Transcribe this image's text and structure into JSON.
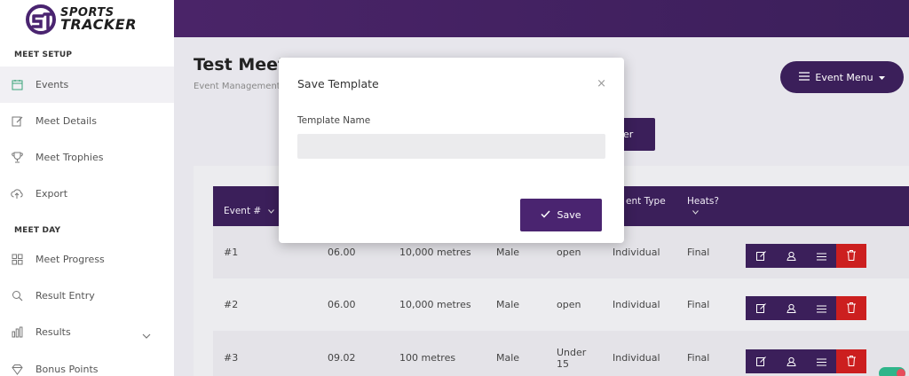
{
  "app": {
    "logo_line1": "SPORTS",
    "logo_line2": "TRACKER"
  },
  "sidebar": {
    "sections": [
      {
        "label": "MEET SETUP"
      },
      {
        "label": "MEET DAY"
      }
    ],
    "items": [
      {
        "label": "Events",
        "icon": "calendar-icon"
      },
      {
        "label": "Meet Details",
        "icon": "edit-icon"
      },
      {
        "label": "Meet Trophies",
        "icon": "trophy-icon"
      },
      {
        "label": "Export",
        "icon": "cloud-upload-icon"
      },
      {
        "label": "Meet Progress",
        "icon": "grid-icon"
      },
      {
        "label": "Result Entry",
        "icon": "search-icon"
      },
      {
        "label": "Results",
        "icon": "bar-chart-icon"
      },
      {
        "label": "Bonus Points",
        "icon": "diamond-icon"
      }
    ]
  },
  "header": {
    "title": "Test Meet",
    "subtitle": "Event Management",
    "event_menu_label": "Event Menu",
    "behind_button_label": "er"
  },
  "table": {
    "columns": [
      "Event #",
      "ent Type",
      "Heats?"
    ],
    "rows": [
      {
        "num": "#1",
        "time": "06.00",
        "distance": "10,000 metres",
        "gender": "Male",
        "age": "open",
        "type": "Individual",
        "heats": "Final"
      },
      {
        "num": "#2",
        "time": "06.00",
        "distance": "10,000 metres",
        "gender": "Male",
        "age": "open",
        "type": "Individual",
        "heats": "Final"
      },
      {
        "num": "#3",
        "time": "09.02",
        "distance": "100 metres",
        "gender": "Male",
        "age": "Under 15",
        "type": "Individual",
        "heats": "Final"
      }
    ]
  },
  "modal": {
    "title": "Save Template",
    "close_glyph": "×",
    "field_label": "Template Name",
    "field_value": "",
    "field_placeholder": "",
    "save_label": "Save"
  },
  "colors": {
    "brand_purple": "#3b1f5a",
    "danger_red": "#cc1f1f"
  }
}
